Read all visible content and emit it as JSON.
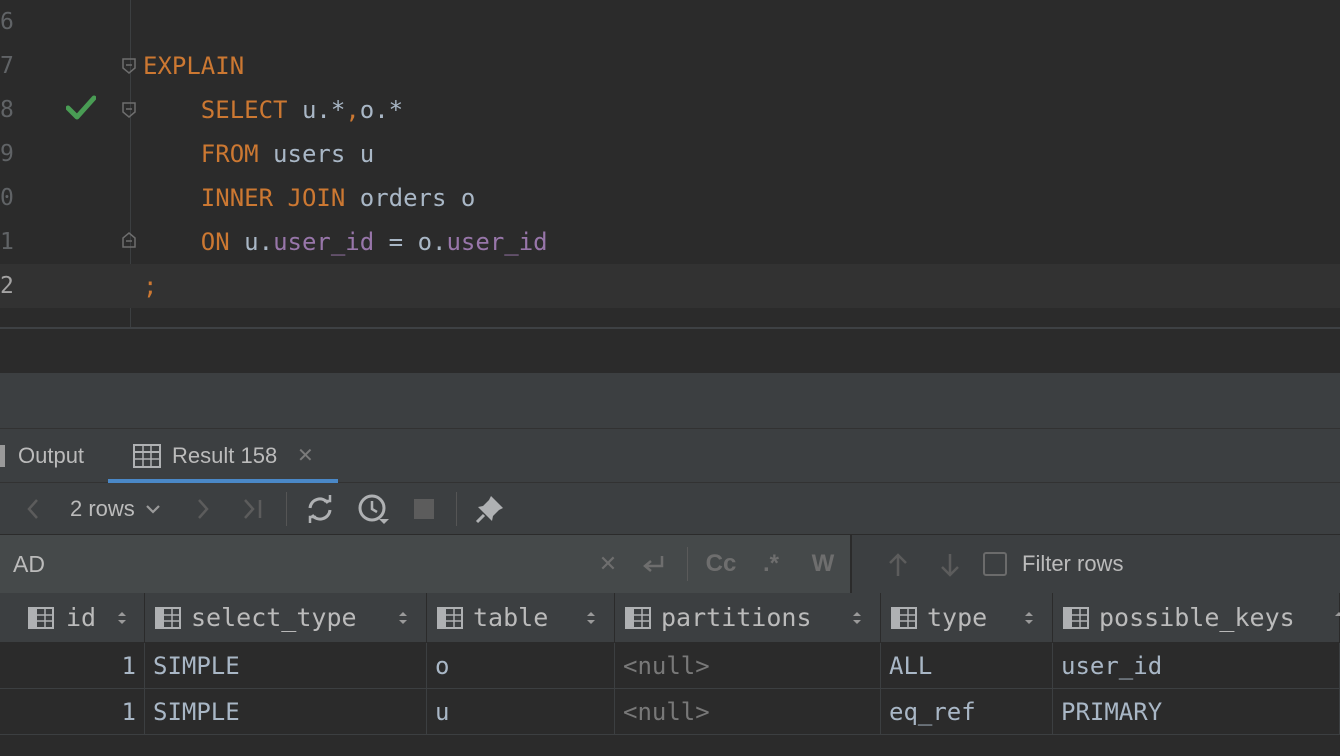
{
  "editor": {
    "lines": [
      {
        "num": "6",
        "code": []
      },
      {
        "num": "7",
        "code": [
          {
            "t": "EXPLAIN",
            "c": "kw"
          }
        ]
      },
      {
        "num": "8",
        "code": [
          {
            "t": "    SELECT ",
            "c": "kw"
          },
          {
            "t": "u.*",
            "c": ""
          },
          {
            "t": ",",
            "c": "kw"
          },
          {
            "t": "o.*",
            "c": ""
          }
        ]
      },
      {
        "num": "9",
        "code": [
          {
            "t": "    FROM ",
            "c": "kw"
          },
          {
            "t": "users u",
            "c": ""
          }
        ]
      },
      {
        "num": "0",
        "code": [
          {
            "t": "    INNER JOIN ",
            "c": "kw"
          },
          {
            "t": "orders o",
            "c": ""
          }
        ]
      },
      {
        "num": "1",
        "code": [
          {
            "t": "    ON ",
            "c": "kw"
          },
          {
            "t": "u.",
            "c": ""
          },
          {
            "t": "user_id",
            "c": "col"
          },
          {
            "t": " = o.",
            "c": ""
          },
          {
            "t": "user_id",
            "c": "col"
          }
        ]
      },
      {
        "num": "2",
        "code": [
          {
            "t": ";",
            "c": "kw"
          }
        ]
      }
    ]
  },
  "tabs": {
    "output_label": "Output",
    "result_label": "Result 158",
    "close_glyph": "✕"
  },
  "toolbar": {
    "rows_label": "2 rows"
  },
  "search": {
    "value": "AD",
    "case_label": "Cc",
    "regex_label": ".*",
    "word_label": "W",
    "filter_rows_label": "Filter rows"
  },
  "table": {
    "columns": [
      "id",
      "select_type",
      "table",
      "partitions",
      "type",
      "possible_keys"
    ],
    "rows": [
      [
        "1",
        "SIMPLE",
        "o",
        "<null>",
        "ALL",
        "user_id"
      ],
      [
        "1",
        "SIMPLE",
        "u",
        "<null>",
        "eq_ref",
        "PRIMARY"
      ]
    ]
  },
  "colors": {
    "keyword": "#cc7832",
    "column": "#9876aa",
    "text": "#a9b7c6",
    "accent": "#4a88c7",
    "check": "#499c54"
  }
}
